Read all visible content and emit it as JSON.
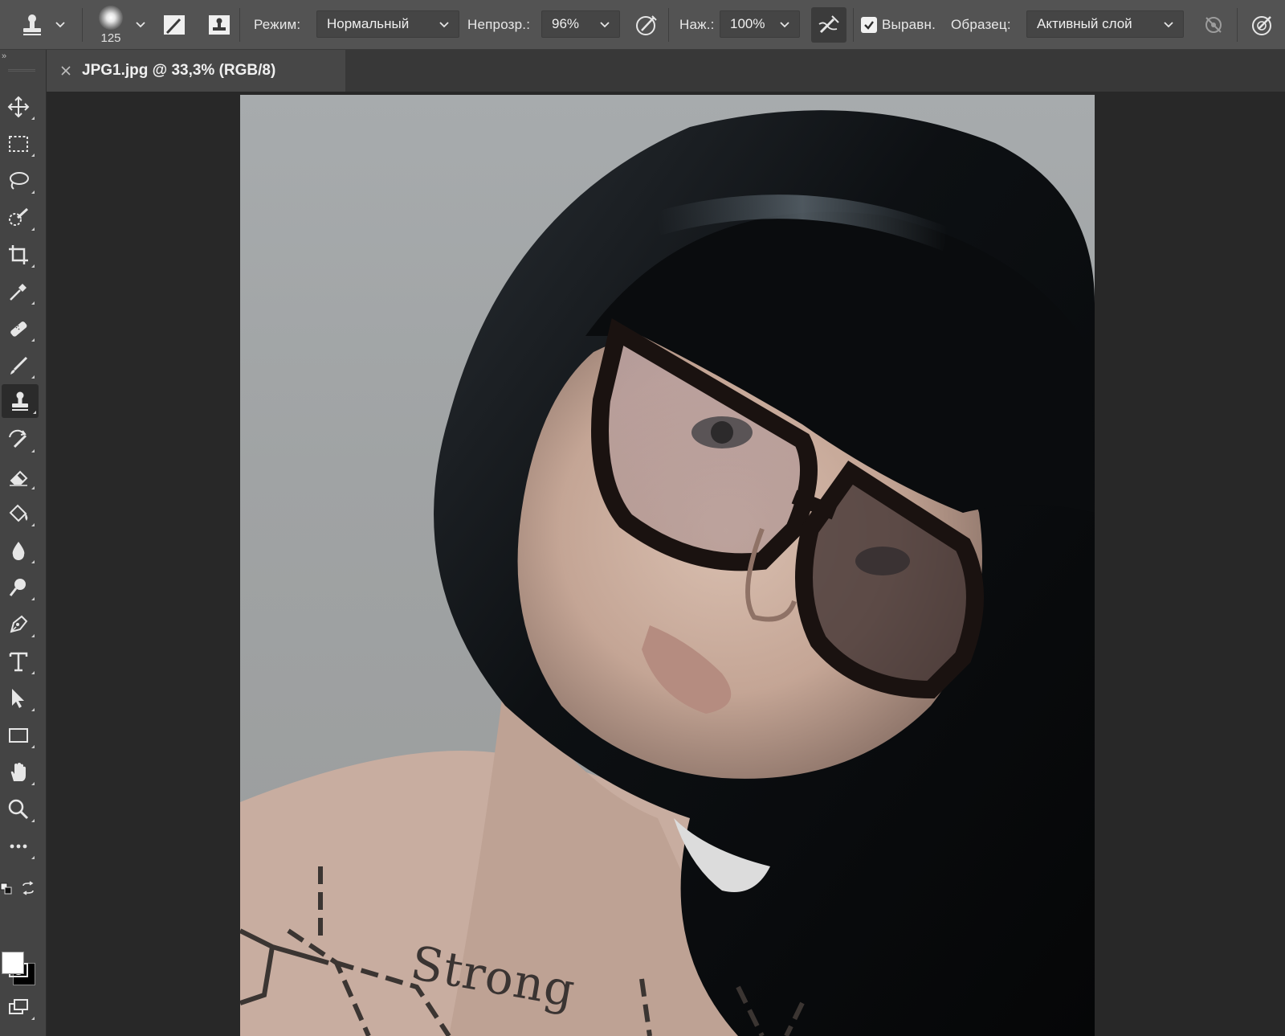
{
  "options_bar": {
    "brush_size": "125",
    "mode_label": "Режим:",
    "mode_value": "Нормальный",
    "opacity_label": "Непрозр.:",
    "opacity_value": "96%",
    "pressure_label": "Наж.:",
    "pressure_value": "100%",
    "aligned_checked": true,
    "aligned_label": "Выравн.",
    "sample_label": "Образец:",
    "sample_value": "Активный слой",
    "icons": [
      "clone-stamp-icon",
      "brush-preset-icon",
      "toggle-brush-panel-icon",
      "toggle-clone-source-icon",
      "opacity-pressure-icon",
      "airbrush-icon",
      "ignore-adjustment-layers-icon",
      "size-pressure-icon"
    ]
  },
  "document_tab": {
    "title": "JPG1.jpg @ 33,3% (RGB/8)"
  },
  "toolbar": {
    "tools": [
      "move",
      "rectangular-marquee",
      "lasso",
      "quick-selection",
      "crop",
      "eyedropper",
      "healing-brush",
      "brush",
      "clone-stamp",
      "history-brush",
      "eraser",
      "paint-bucket",
      "blur",
      "dodge",
      "pen",
      "type",
      "path-selection",
      "rectangle",
      "hand",
      "zoom",
      "edit-toolbar",
      "swap-colors",
      "quick-mask",
      "screen-mode"
    ],
    "active_tool": "clone-stamp",
    "foreground_color": "#ffffff",
    "background_color": "#000000"
  },
  "canvas": {
    "tattoo_text": "Strong"
  }
}
